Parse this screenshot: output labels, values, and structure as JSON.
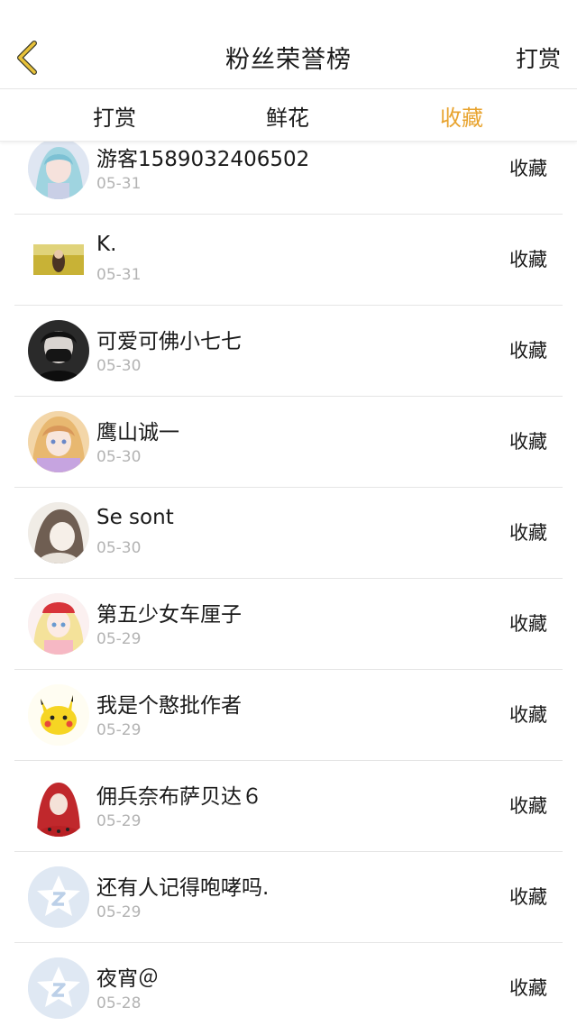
{
  "header": {
    "title": "粉丝荣誉榜",
    "right_label": "打赏",
    "back_icon": "chevron-left-icon",
    "back_color": "#e8c23a"
  },
  "tabs": [
    {
      "label": "打赏",
      "active": false
    },
    {
      "label": "鲜花",
      "active": false
    },
    {
      "label": "收藏",
      "active": true
    }
  ],
  "accent_color": "#e8a430",
  "rows": [
    {
      "name": "游客1589032406502",
      "date": "05-31",
      "action": "收藏",
      "avatar": "anime-girl-blue-avatar"
    },
    {
      "name": "K.",
      "date": "05-31",
      "action": "收藏",
      "avatar": "field-photo-avatar"
    },
    {
      "name": "可爱可佛小七七",
      "date": "05-30",
      "action": "收藏",
      "avatar": "masked-figure-avatar"
    },
    {
      "name": "鹰山诚一",
      "date": "05-30",
      "action": "收藏",
      "avatar": "anime-girl-avatar"
    },
    {
      "name": "Se sont",
      "date": "05-30",
      "action": "收藏",
      "avatar": "sketch-avatar"
    },
    {
      "name": "第五少女车厘子",
      "date": "05-29",
      "action": "收藏",
      "avatar": "anime-girl-red-hat-avatar"
    },
    {
      "name": "我是个憨批作者",
      "date": "05-29",
      "action": "收藏",
      "avatar": "pikachu-avatar"
    },
    {
      "name": "佣兵奈布萨贝达６",
      "date": "05-29",
      "action": "收藏",
      "avatar": "red-hood-avatar"
    },
    {
      "name": "还有人记得咆哮吗.",
      "date": "05-29",
      "action": "收藏",
      "avatar": "default-star-avatar"
    },
    {
      "name": "夜宵＠",
      "date": "05-28",
      "action": "收藏",
      "avatar": "default-star-avatar"
    }
  ]
}
